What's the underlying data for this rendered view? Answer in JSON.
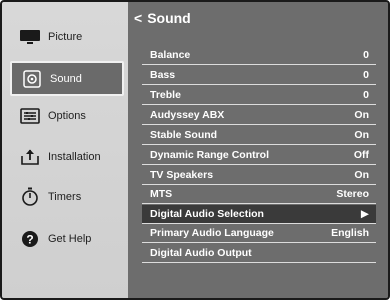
{
  "menu_title": "Sound",
  "sidebar": {
    "items": [
      {
        "label": "Picture",
        "icon": "tv-monitor-icon",
        "active": false
      },
      {
        "label": "Sound",
        "icon": "speaker-icon",
        "active": true
      },
      {
        "label": "Options",
        "icon": "options-panel-icon",
        "active": false
      },
      {
        "label": "Installation",
        "icon": "installation-icon",
        "active": false
      },
      {
        "label": "Timers",
        "icon": "stopwatch-icon",
        "active": false
      },
      {
        "label": "Get Help",
        "icon": "help-icon",
        "active": false
      }
    ]
  },
  "settings": [
    {
      "label": "Balance",
      "value": "0"
    },
    {
      "label": "Bass",
      "value": "0"
    },
    {
      "label": "Treble",
      "value": "0"
    },
    {
      "label": "Audyssey ABX",
      "value": "On"
    },
    {
      "label": "Stable Sound",
      "value": "On"
    },
    {
      "label": "Dynamic Range Control",
      "value": "Off"
    },
    {
      "label": "TV Speakers",
      "value": "On"
    },
    {
      "label": "MTS",
      "value": "Stereo"
    },
    {
      "label": "Digital Audio Selection",
      "value": "▶",
      "selected": true
    },
    {
      "label": "Primary Audio Language",
      "value": "English"
    },
    {
      "label": "Digital Audio Output",
      "value": ""
    }
  ],
  "colors": {
    "sidebar_bg": "#d3d3d3",
    "main_bg": "#6d6d6d",
    "selected_row_bg": "#3a3a3a",
    "text": "#ffffff"
  }
}
